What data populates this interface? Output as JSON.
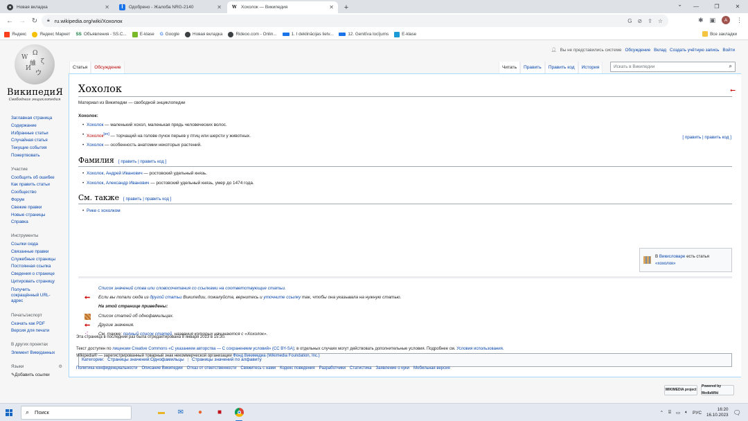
{
  "browser": {
    "tabs": [
      {
        "title": "Новая вкладка",
        "icon": "chrome-icon",
        "color": "#3c4043"
      },
      {
        "title": "Одобрено - Жалоба NRG-2140",
        "icon": "portal-icon",
        "color": "#1a73e8"
      },
      {
        "title": "Хохолок — Википедия",
        "icon": "wikipedia-icon",
        "color": "#202122"
      }
    ],
    "new_tab": "+",
    "url": "ru.wikipedia.org/wiki/Хохолок",
    "profile_initial": "A",
    "bookmarks": [
      {
        "label": "Яндекс",
        "color": "#fc3f1d"
      },
      {
        "label": "Яндекс Маркет",
        "color": "#f5c000"
      },
      {
        "label": "Объявления - SS.C...",
        "color": "#0b7a3b",
        "prefix": "SS"
      },
      {
        "label": "E-klase",
        "color": "#78b928"
      },
      {
        "label": "Google",
        "color": "#4285f4",
        "prefix": "G"
      },
      {
        "label": "Новая вкладка",
        "color": "#3c4043"
      },
      {
        "label": "Rideoo.com - Onlin...",
        "color": "#3c4043"
      },
      {
        "label": "1. I deklinācijas lietv...",
        "color": "#1a73e8"
      },
      {
        "label": "12. Genitīva locījums",
        "color": "#1a73e8"
      },
      {
        "label": "E-klase",
        "color": "#1a9ad6"
      }
    ],
    "all_bookmarks": "Все закладки"
  },
  "wiki": {
    "wordmark": "ВикипедиЯ",
    "tagline": "Свободная энциклопедия",
    "personal": {
      "anon": "Вы не представились системе",
      "links": [
        "Обсуждение",
        "Вклад",
        "Создать учётную запись",
        "Войти"
      ]
    },
    "ns_tabs": [
      {
        "label": "Статья",
        "selected": true
      },
      {
        "label": "Обсуждение",
        "red": true
      }
    ],
    "view_tabs": [
      {
        "label": "Читать",
        "selected": true
      },
      {
        "label": "Править"
      },
      {
        "label": "Править код"
      },
      {
        "label": "История"
      }
    ],
    "search_placeholder": "Искать в Википедии",
    "sidebar": {
      "main": [
        "Заглавная страница",
        "Содержание",
        "Избранные статьи",
        "Случайная статья",
        "Текущие события",
        "Пожертвовать"
      ],
      "participation_heading": "Участие",
      "participation": [
        "Сообщить об ошибке",
        "Как править статьи",
        "Сообщество",
        "Форум",
        "Свежие правки",
        "Новые страницы",
        "Справка"
      ],
      "tools_heading": "Инструменты",
      "tools": [
        "Ссылки сюда",
        "Связанные правки",
        "Служебные страницы",
        "Постоянная ссылка",
        "Сведения о странице",
        "Цитировать страницу",
        "Получить сокращённый URL-адрес"
      ],
      "print_heading": "Печать/экспорт",
      "print": [
        "Скачать как PDF",
        "Версия для печати"
      ],
      "projects_heading": "В других проектах",
      "projects": [
        "Элемент Викиданных"
      ],
      "languages_heading": "Языки",
      "add_links": "Добавить ссылки"
    },
    "article": {
      "title": "Хохолок",
      "site_sub": "Материал из Википедии — свободной энциклопедии",
      "edit_links": "[ править | править код ]",
      "intro": "Хохолок:",
      "intro_items": [
        {
          "link": "Хохолок",
          "rest": " — маленький хохол, маленькая прядь человеческих волос."
        },
        {
          "link": "Хохолок",
          "sup": "[en]",
          "rest": " — торчащий на голове пучок перьев у птиц или шерсти у животных.",
          "red": true
        },
        {
          "link": "Хохолок",
          "rest": " — особенность анатомии некоторых растений."
        }
      ],
      "surname_heading": "Фамилия",
      "section_edit": "[ править | править код ]",
      "surname_items": [
        {
          "link": "Хохолок, Андрей Иванович",
          "rest": " — ростовский удельный князь."
        },
        {
          "link": "Хохолок, Александр Иванович",
          "rest": " — ростовский удельный князь, умер до 1474 года."
        }
      ],
      "see_also_heading": "См. также",
      "see_also_items": [
        {
          "link": "Рике с хохолком"
        }
      ],
      "wiktionary_pre": "В ",
      "wiktionary_link": "Викисловаре",
      "wiktionary_mid": " есть статья",
      "wiktionary_term": "«хохолок»",
      "dmb": {
        "l1": "Список значений слова или словосочетания со ссылками на соответствующие статьи.",
        "l2a": "Если вы попали сюда из ",
        "l2b": "другой статьи",
        "l2c": " Википедии, пожалуйста, вернитесь и ",
        "l2d": "уточните ссылку",
        "l2e": " так, чтобы она указывала на нужную статью.",
        "l3": "На этой странице приведены:",
        "l4": "Список статей об однофамильцах.",
        "l5": "Другие значения.",
        "l6a": "См. также: ",
        "l6b": "полный список статей",
        "l6c": ", названия которых начинаются с «Хохолок»."
      },
      "categories_label": "Категории:",
      "categories": [
        "Страницы значений:Однофамильцы",
        "Страницы значений по алфавиту"
      ]
    },
    "footer": {
      "lastmod": "Эта страница в последний раз была отредактирована 8 января 2023 в 15:30.",
      "license_pre": "Текст доступен по ",
      "license_link": "лицензии Creative Commons «С указанием авторства — С сохранением условий» (CC BY-SA)",
      "license_post": "; в отдельных случаях могут действовать дополнительные условия. Подробнее см. ",
      "terms": "Условия использования.",
      "tm": "Wikipedia® — зарегистрированный товарный знак некоммерческой организации ",
      "foundation": "Фонд Викимедиа (Wikimedia Foundation, Inc.)",
      "links": [
        "Политика конфиденциальности",
        "Описание Википедии",
        "Отказ от ответственности",
        "Свяжитесь с нами",
        "Кодекс поведения",
        "Разработчики",
        "Статистика",
        "Заявление о куки",
        "Мобильная версия"
      ],
      "badge1": "WIKIMEDIA project",
      "badge2": "Powered by MediaWiki"
    }
  },
  "taskbar": {
    "search": "Поиск",
    "lang": "РУС",
    "time": "16:20",
    "date": "16.10.2023"
  }
}
